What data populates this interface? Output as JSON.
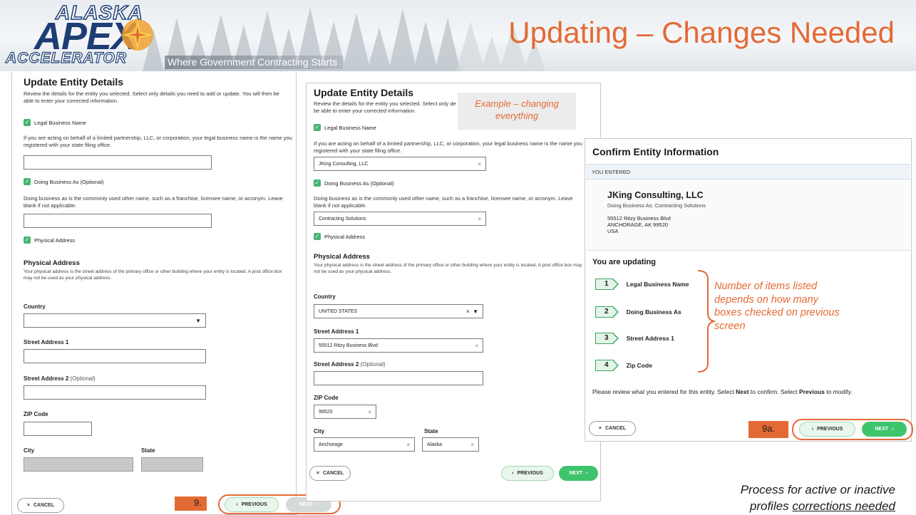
{
  "header": {
    "logo_top": "ALASKA",
    "logo_main": "APEX",
    "logo_bottom": "ACCELERATOR",
    "tagline": "Where Government Contracting Starts",
    "slide_title": "Updating – Changes Needed",
    "accent_color": "#e46a35",
    "brand_color": "#1d3e74"
  },
  "left_form": {
    "title": "Update Entity Details",
    "intro": "Review the details for the entity you selected. Select only details you need to add or update. You will then be able to enter your corrected information.",
    "check_legal": "Legal Business Name",
    "legal_help": "If you are acting on behalf of a limited partnership, LLC, or corporation, your legal business name is the name you registered with your state filing office.",
    "legal_value": "",
    "check_dba": "Doing Business As (Optional)",
    "dba_help": "Doing business as is the commonly used other name, such as a franchise, licensee name, or acronym. Leave blank if not applicable.",
    "dba_value": "",
    "check_physical": "Physical Address",
    "physical_heading": "Physical Address",
    "physical_help": "Your physical address is the street address of the primary office or other building where your entity is located. A post office box may not be used as your physical address.",
    "country_label": "Country",
    "country_value": "",
    "street1_label": "Street Address 1",
    "street2_label": "Street Address 2",
    "optional": "(Optional)",
    "zip_label": "ZIP Code",
    "city_label": "City",
    "state_label": "State",
    "cancel": "CANCEL",
    "previous": "PREVIOUS",
    "next": "NEXT",
    "step": "9."
  },
  "middle_form": {
    "title": "Update Entity Details",
    "intro": "Review the details for the entity you selected. Select only de be able to enter your corrected information.",
    "check_legal": "Legal Business Name",
    "legal_help": "If you are acting on behalf of a limited partnership, LLC, or corporation, your legal business name is the name you registered with your state filing office.",
    "legal_value": "JKing Consulting, LLC",
    "check_dba": "Doing Business As (Optional)",
    "dba_help": "Doing business as is the commonly used other name, such as a franchise, licensee name, or acronym. Leave blank if not applicable.",
    "dba_value": "Contracting Solutions",
    "check_physical": "Physical Address",
    "physical_heading": "Physical Address",
    "physical_help": "Your physical address is the street address of the primary office or other building where your entity is located. A post office box may not be used as your physical address.",
    "country_label": "Country",
    "country_value": "UNITED STATES",
    "street1_label": "Street Address 1",
    "street1_value": "55512 Ritzy Business Blvd",
    "street2_label": "Street Address 2",
    "optional": "(Optional)",
    "zip_label": "ZIP Code",
    "zip_value": "99520",
    "city_label": "City",
    "city_value": "Anchorage",
    "state_label": "State",
    "state_value": "Alaska",
    "cancel": "CANCEL",
    "previous": "PREVIOUS",
    "next": "NEXT",
    "callout": "Example – changing everything"
  },
  "confirm": {
    "title": "Confirm Entity Information",
    "you_entered": "YOU ENTERED",
    "entity_name": "JKing Consulting, LLC",
    "dba_line": "Doing Business As: Contracting Solutions",
    "address1": "55512 Ritzy Business Blvd",
    "address2": "ANCHORAGE, AK 99520",
    "address3": "USA",
    "updating_heading": "You are updating",
    "items": [
      {
        "num": "1",
        "label": "Legal Business Name"
      },
      {
        "num": "2",
        "label": "Doing Business As"
      },
      {
        "num": "3",
        "label": "Street Address 1"
      },
      {
        "num": "4",
        "label": "Zip Code"
      }
    ],
    "review_pre": "Please review what you entered for this entity. Select ",
    "review_next": "Next",
    "review_mid": " to confirm. Select ",
    "review_prev": "Previous",
    "review_post": " to modify.",
    "cancel": "CANCEL",
    "previous": "PREVIOUS",
    "next": "NEXT",
    "step": "9a.",
    "callout": "Number of items listed depends on how many boxes checked on previous screen"
  },
  "footer_note": {
    "line1": "Process for active or inactive",
    "line2_pre": "profiles ",
    "line2_u": "corrections needed"
  }
}
